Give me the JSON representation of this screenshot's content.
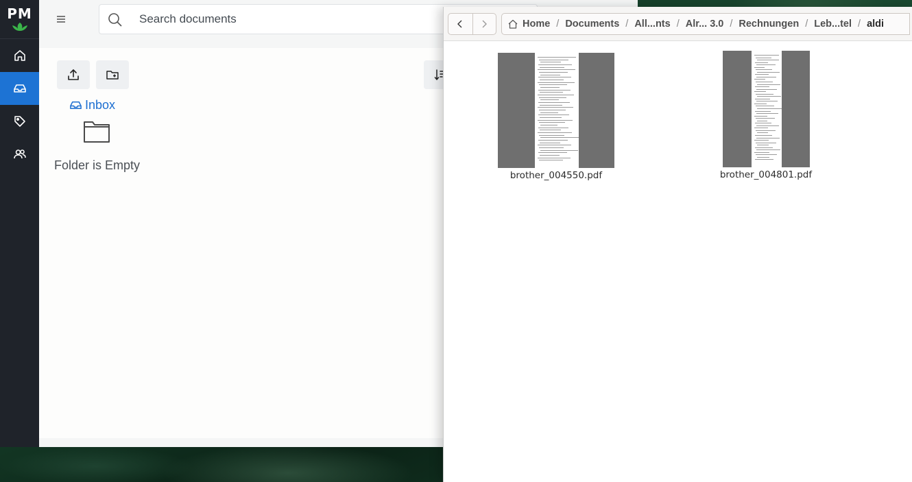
{
  "app": {
    "logo_text": "PM",
    "search": {
      "placeholder": "Search documents",
      "value": ""
    },
    "nav_items": [
      {
        "name": "home",
        "icon": "home-icon",
        "active": false
      },
      {
        "name": "inbox",
        "icon": "inbox-icon",
        "active": true
      },
      {
        "name": "tags",
        "icon": "tag-icon",
        "active": false
      },
      {
        "name": "users",
        "icon": "users-icon",
        "active": false
      }
    ],
    "inbox_label": "Inbox",
    "empty_message": "Folder is Empty",
    "accent_color": "#1d73d4"
  },
  "file_manager": {
    "breadcrumb": [
      {
        "label": "Home",
        "icon": "home-icon"
      },
      {
        "label": "Documents"
      },
      {
        "label": "All...nts"
      },
      {
        "label": "Alr... 3.0"
      },
      {
        "label": "Rechnungen"
      },
      {
        "label": "Leb...tel"
      },
      {
        "label": "aldi",
        "current": true
      }
    ],
    "files": [
      {
        "name": "brother_004550.pdf",
        "type": "pdf"
      },
      {
        "name": "brother_004801.pdf",
        "type": "pdf"
      }
    ]
  }
}
